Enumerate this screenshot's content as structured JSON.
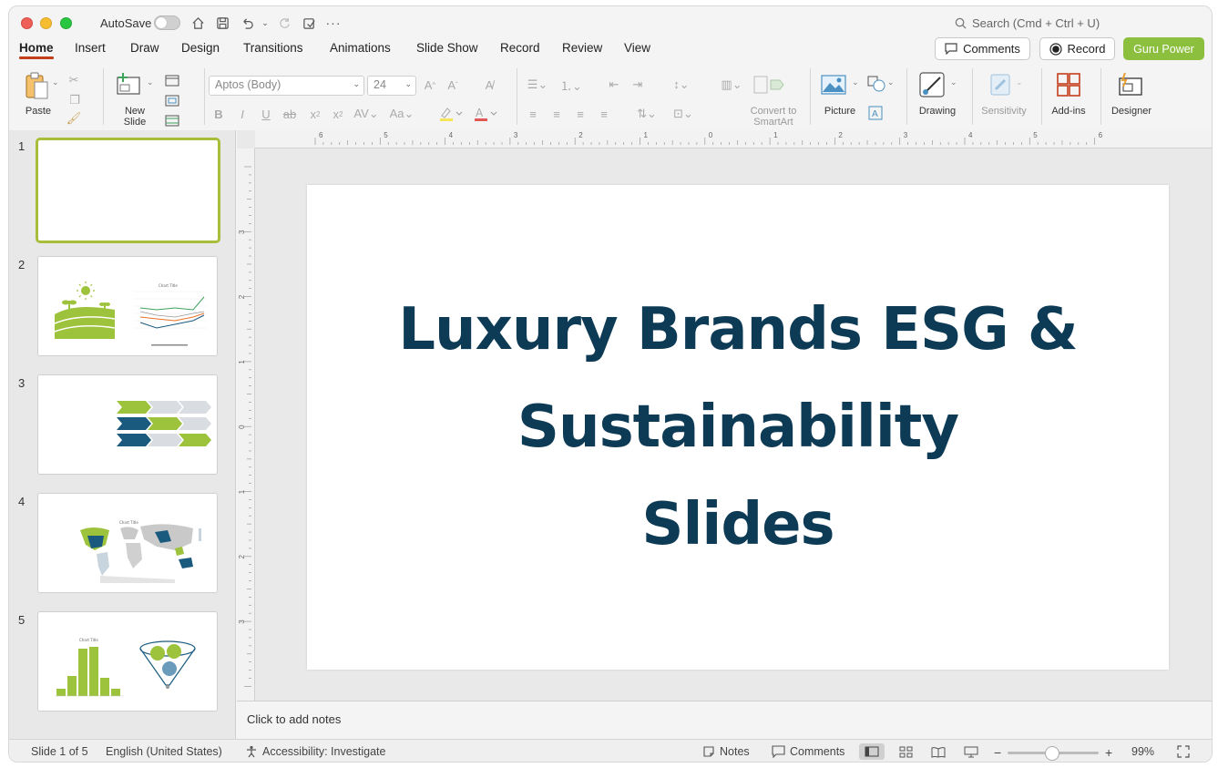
{
  "titlebar": {
    "autosave_label": "AutoSave",
    "search_placeholder": "Search (Cmd + Ctrl + U)"
  },
  "tabs": [
    {
      "label": "Home",
      "active": true
    },
    {
      "label": "Insert"
    },
    {
      "label": "Draw"
    },
    {
      "label": "Design"
    },
    {
      "label": "Transitions"
    },
    {
      "label": "Animations"
    },
    {
      "label": "Slide Show"
    },
    {
      "label": "Record"
    },
    {
      "label": "Review"
    },
    {
      "label": "View"
    }
  ],
  "header_buttons": {
    "comments": "Comments",
    "record": "Record",
    "guru": "Guru Power"
  },
  "ribbon": {
    "paste": "Paste",
    "new_slide_1": "New",
    "new_slide_2": "Slide",
    "font_name": "Aptos (Body)",
    "font_size": "24",
    "convert_1": "Convert to",
    "convert_2": "SmartArt",
    "picture": "Picture",
    "drawing": "Drawing",
    "sensitivity": "Sensitivity",
    "addins": "Add-ins",
    "designer": "Designer"
  },
  "slides": [
    {
      "num": "1"
    },
    {
      "num": "2",
      "chart_title": "Chart Title"
    },
    {
      "num": "3"
    },
    {
      "num": "4",
      "chart_title": "Chart Title"
    },
    {
      "num": "5",
      "chart_title": "Chart Title"
    }
  ],
  "rulers": {
    "h": [
      "6",
      "5",
      "4",
      "3",
      "2",
      "1",
      "0",
      "1",
      "2",
      "3",
      "4",
      "5",
      "6"
    ],
    "v": [
      "3",
      "2",
      "1",
      "0",
      "1",
      "2",
      "3"
    ]
  },
  "main_slide": {
    "title_line1": "Luxury Brands ESG &",
    "title_line2": "Sustainability",
    "title_line3": "Slides"
  },
  "notes_placeholder": "Click to add notes",
  "status": {
    "slide_pos": "Slide 1 of 5",
    "language": "English (United States)",
    "accessibility": "Accessibility: Investigate",
    "notes": "Notes",
    "comments": "Comments",
    "zoom": "99%"
  },
  "colors": {
    "accent_red": "#c43e1c",
    "guru_green": "#8dbf3f",
    "title_navy": "#0d3a55",
    "thumb_green": "#a8be3a"
  }
}
